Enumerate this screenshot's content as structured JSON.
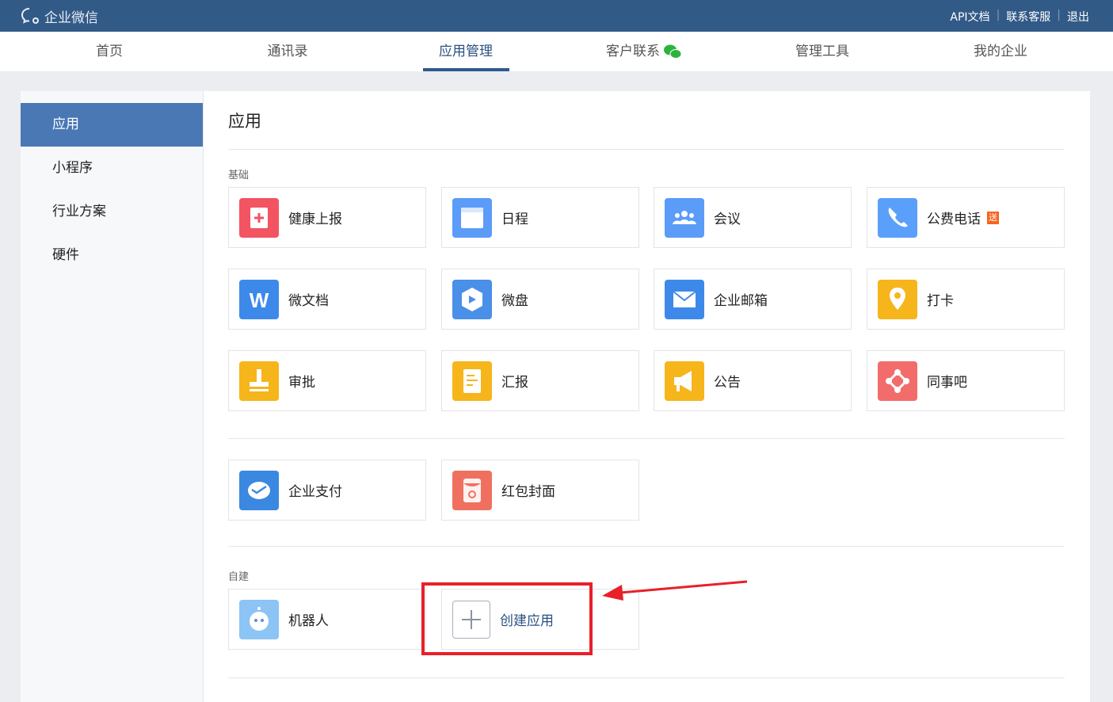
{
  "header": {
    "brand": "企业微信",
    "links": [
      "API文档",
      "联系客服",
      "退出"
    ]
  },
  "nav": {
    "tabs": [
      "首页",
      "通讯录",
      "应用管理",
      "客户联系",
      "管理工具",
      "我的企业"
    ],
    "active": 2
  },
  "sidebar": {
    "items": [
      "应用",
      "小程序",
      "行业方案",
      "硬件"
    ],
    "active": 0
  },
  "main": {
    "title": "应用",
    "section_basic": "基础",
    "section_custom": "自建",
    "basic_apps": [
      {
        "label": "健康上报",
        "icon": "health-report-icon",
        "color": "#f25461"
      },
      {
        "label": "日程",
        "icon": "calendar-icon",
        "color": "#5a9cf8"
      },
      {
        "label": "会议",
        "icon": "meeting-icon",
        "color": "#5a9cf8"
      },
      {
        "label": "公费电话",
        "icon": "phone-icon",
        "color": "#5aa0fa",
        "badge": "送"
      },
      {
        "label": "微文档",
        "icon": "doc-icon",
        "color": "#3d89ea"
      },
      {
        "label": "微盘",
        "icon": "drive-icon",
        "color": "#4a8fe8"
      },
      {
        "label": "企业邮箱",
        "icon": "mail-icon",
        "color": "#3d89ea"
      },
      {
        "label": "打卡",
        "icon": "checkin-icon",
        "color": "#f5b51b"
      },
      {
        "label": "审批",
        "icon": "approval-icon",
        "color": "#f5b51b"
      },
      {
        "label": "汇报",
        "icon": "report-icon",
        "color": "#f5b51b"
      },
      {
        "label": "公告",
        "icon": "announcement-icon",
        "color": "#f5b51b"
      },
      {
        "label": "同事吧",
        "icon": "colleague-icon",
        "color": "#f36c6c"
      }
    ],
    "extra_apps": [
      {
        "label": "企业支付",
        "icon": "payment-icon",
        "color": "#3a88e0"
      },
      {
        "label": "红包封面",
        "icon": "red-envelope-icon",
        "color": "#f07060"
      }
    ],
    "custom_apps": [
      {
        "label": "机器人",
        "icon": "robot-icon",
        "color": "#8cc4f5"
      }
    ],
    "create_label": "创建应用"
  }
}
